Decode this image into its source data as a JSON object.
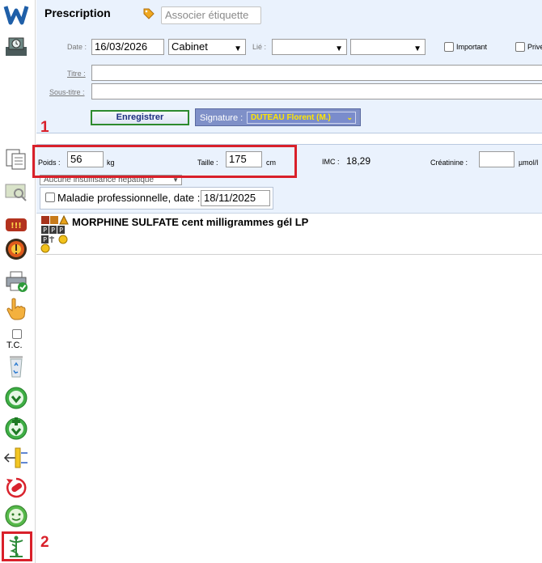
{
  "header": {
    "title": "Prescription",
    "tag_button": "Associer étiquette",
    "date_label": "Date :",
    "date_value": "16/03/2026",
    "location_value": "Cabinet",
    "linked_label": "Lié :",
    "important_label": "Important",
    "private_label": "Privé",
    "title_label": "Titre :",
    "subtitle_label": "Sous-titre :",
    "save_button": "Enregistrer",
    "signature_label": "Signature :",
    "signature_value": "DUTEAU Florent (M.)"
  },
  "patient": {
    "weight_label": "Poids :",
    "weight_value": "56",
    "weight_unit": "kg",
    "height_label": "Taille :",
    "height_value": "175",
    "height_unit": "cm",
    "bmi_label": "IMC :",
    "bmi_value": "18,29",
    "creatinine_label": "Créatinine :",
    "creatinine_value": "",
    "creatinine_unit": "µmol/l",
    "hepatic_select": "Aucune insuffisance hépatique",
    "occupational_label": "Maladie professionnelle, date :",
    "occupational_date": "18/11/2025"
  },
  "prescription": {
    "items": [
      {
        "name": "MORPHINE SULFATE cent milligrammes gél LP"
      }
    ]
  },
  "sidebar": {
    "tc_label": "T.C."
  },
  "annotations": {
    "callout_1": "1",
    "callout_2": "2"
  },
  "colors": {
    "panel_bg": "#eaf2fd",
    "signature_bg": "#7f90c8",
    "signature_value": "#ffe600",
    "highlight_red": "#d9202a",
    "save_border": "#2d8a2d",
    "save_text": "#1d2f80"
  },
  "icons": [
    "app-logo-icon",
    "agenda-icon",
    "document-copy-icon",
    "search-icon",
    "drug-interaction-icon",
    "alert-icon",
    "print-icon",
    "hand-pointer-icon",
    "recycle-bin-icon",
    "green-check-icon",
    "green-add-icon",
    "arrow-left-bar-icon",
    "pill-refresh-icon",
    "smiley-icon",
    "caduceus-icon"
  ]
}
